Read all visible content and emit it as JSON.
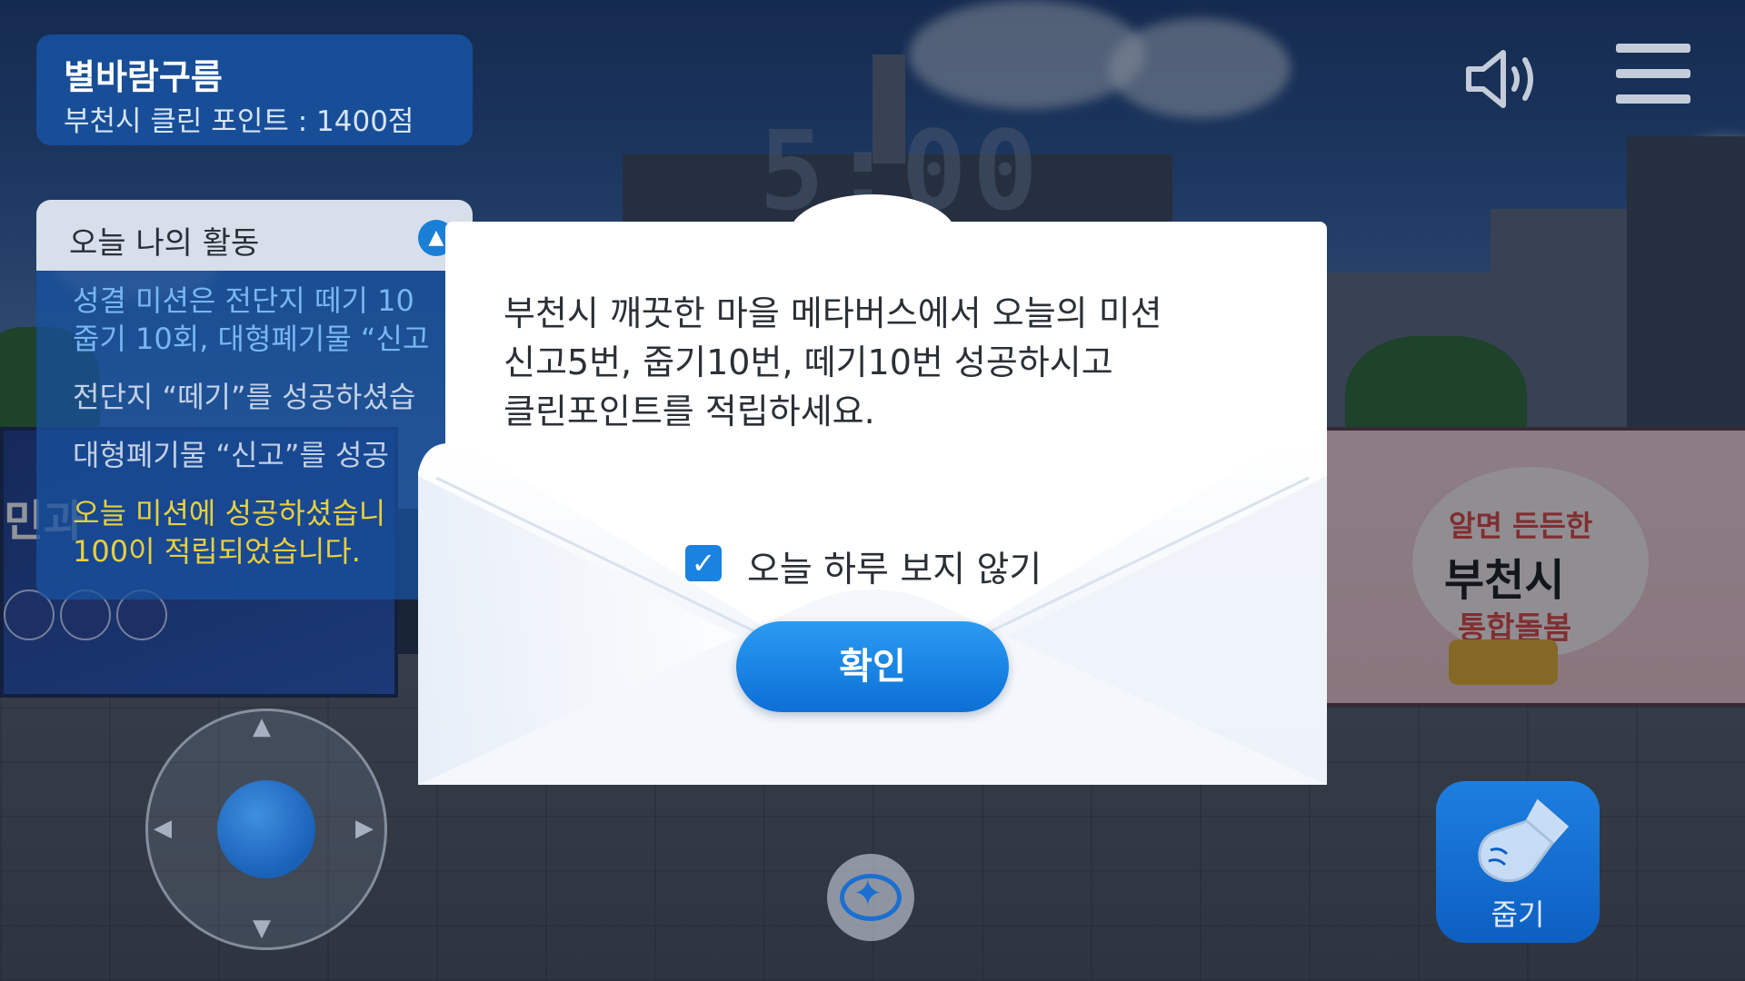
{
  "hud": {
    "player_name": "별바람구름",
    "points_text": "부천시 클린 포인트 : 1400점"
  },
  "activity": {
    "title": "오늘 나의 활동",
    "items": [
      {
        "text": "성결 미션은 전단지 떼기 10",
        "tone": "blue"
      },
      {
        "text": "줍기 10회, 대형폐기물 “신고",
        "tone": "blue"
      },
      {
        "text": "전단지 “떼기”를 성공하셨습",
        "tone": "normal"
      },
      {
        "text": "대형폐기물 “신고”를 성공",
        "tone": "normal"
      },
      {
        "text": "오늘 미션에 성공하셨습니",
        "tone": "gold"
      },
      {
        "text": "100이 적립되었습니다.",
        "tone": "gold"
      }
    ]
  },
  "scene": {
    "timer": "5:00",
    "left_banner_text": "민과",
    "right_banner": {
      "line1": "알면 든든한",
      "line2": "부천시",
      "line3": "통합돌봄"
    }
  },
  "modal": {
    "message_lines": [
      "부천시 깨끗한 마을 메타버스에서 오늘의 미션",
      "신고5번, 줍기10번, 떼기10번 성공하시고",
      "클린포인트를 적립하세요."
    ],
    "checkbox_label": "오늘 하루 보지 않기",
    "checkbox_checked": true,
    "confirm_label": "확인"
  },
  "controls": {
    "pickup_label": "줍기"
  },
  "colors": {
    "accent": "#1a82e0",
    "hud_panel": "#1852a0",
    "mission_gold": "#e9cf3e"
  },
  "icons": {
    "sound": "speaker-icon",
    "menu": "hamburger-menu-icon",
    "collapse": "chevron-up-icon",
    "compass": "compass-icon",
    "pickup": "hand-pickup-icon",
    "check": "checkmark-icon"
  }
}
